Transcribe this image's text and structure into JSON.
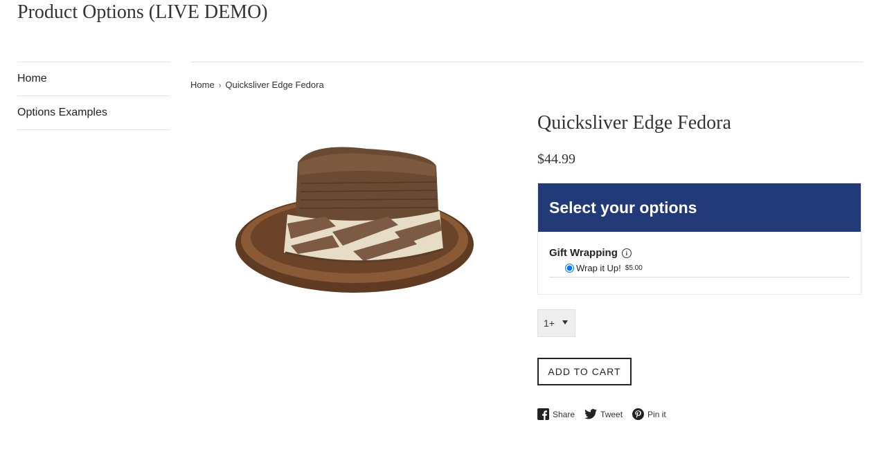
{
  "site": {
    "title": "Product Options (LIVE DEMO)"
  },
  "sidebar": {
    "items": [
      {
        "label": "Home"
      },
      {
        "label": "Options Examples"
      }
    ]
  },
  "breadcrumb": {
    "home": "Home",
    "separator": "›",
    "current": "Quicksliver Edge Fedora"
  },
  "product": {
    "title": "Quicksliver Edge Fedora",
    "price": "$44.99",
    "image_icon": "fedora-hat-image"
  },
  "options": {
    "header": "Select your options",
    "header_color": "#233a78",
    "group_label": "Gift Wrapping",
    "info_icon": "i",
    "choice_label": "Wrap it Up!",
    "choice_price": "$5.00",
    "choice_selected": true
  },
  "quantity": {
    "value": "1+"
  },
  "cart": {
    "add_label": "ADD TO CART"
  },
  "share": {
    "facebook": "Share",
    "twitter": "Tweet",
    "pinterest": "Pin it"
  }
}
